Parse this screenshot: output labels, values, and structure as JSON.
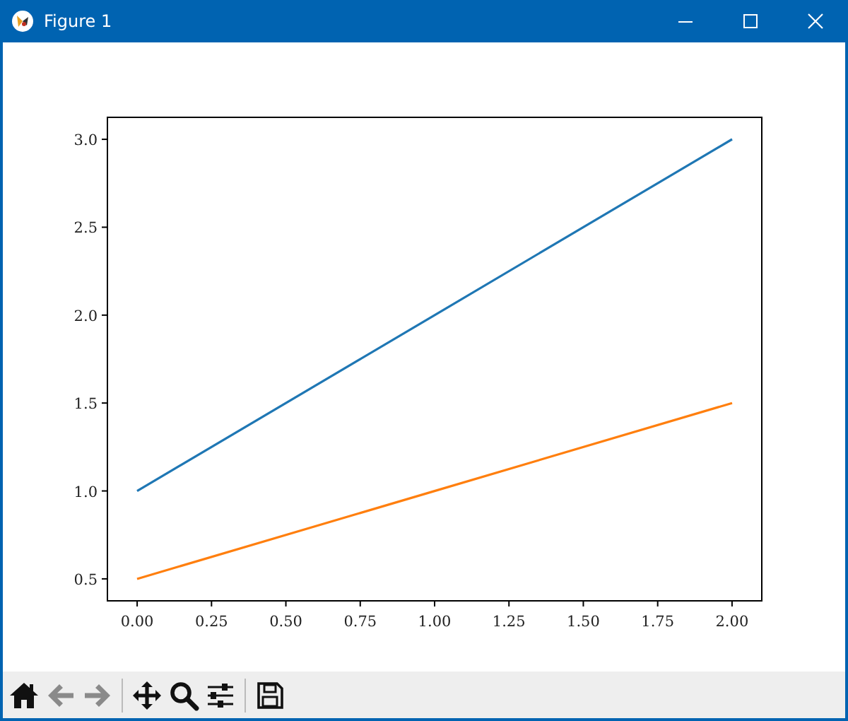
{
  "window": {
    "title": "Figure 1"
  },
  "figure": {
    "chart_data": {
      "type": "line",
      "x": [
        0,
        1,
        2
      ],
      "series": [
        {
          "color": "#1f77b4",
          "values": [
            1.0,
            2.0,
            3.0
          ]
        },
        {
          "color": "#ff7f0e",
          "values": [
            0.5,
            1.0,
            1.5
          ]
        }
      ],
      "xlim": [
        -0.1,
        2.1
      ],
      "ylim": [
        0.375,
        3.125
      ],
      "xticks": [
        {
          "value": 0,
          "label": "0.00"
        },
        {
          "value": 0.25,
          "label": "0.25"
        },
        {
          "value": 0.5,
          "label": "0.50"
        },
        {
          "value": 0.75,
          "label": "0.75"
        },
        {
          "value": 1,
          "label": "1.00"
        },
        {
          "value": 1.25,
          "label": "1.25"
        },
        {
          "value": 1.5,
          "label": "1.50"
        },
        {
          "value": 1.75,
          "label": "1.75"
        },
        {
          "value": 2,
          "label": "2.00"
        }
      ],
      "yticks": [
        {
          "value": 0.5,
          "label": "0.5"
        },
        {
          "value": 1,
          "label": "1.0"
        },
        {
          "value": 1.5,
          "label": "1.5"
        },
        {
          "value": 2,
          "label": "2.0"
        },
        {
          "value": 2.5,
          "label": "2.5"
        },
        {
          "value": 3,
          "label": "3.0"
        }
      ]
    }
  },
  "toolbar": [
    {
      "kind": "home",
      "disabled": false
    },
    {
      "kind": "back",
      "disabled": true
    },
    {
      "kind": "forward",
      "disabled": true
    },
    {
      "kind": "separator"
    },
    {
      "kind": "pan",
      "disabled": false
    },
    {
      "kind": "zoom",
      "disabled": false
    },
    {
      "kind": "configure",
      "disabled": false
    },
    {
      "kind": "separator"
    },
    {
      "kind": "save",
      "disabled": false
    }
  ]
}
